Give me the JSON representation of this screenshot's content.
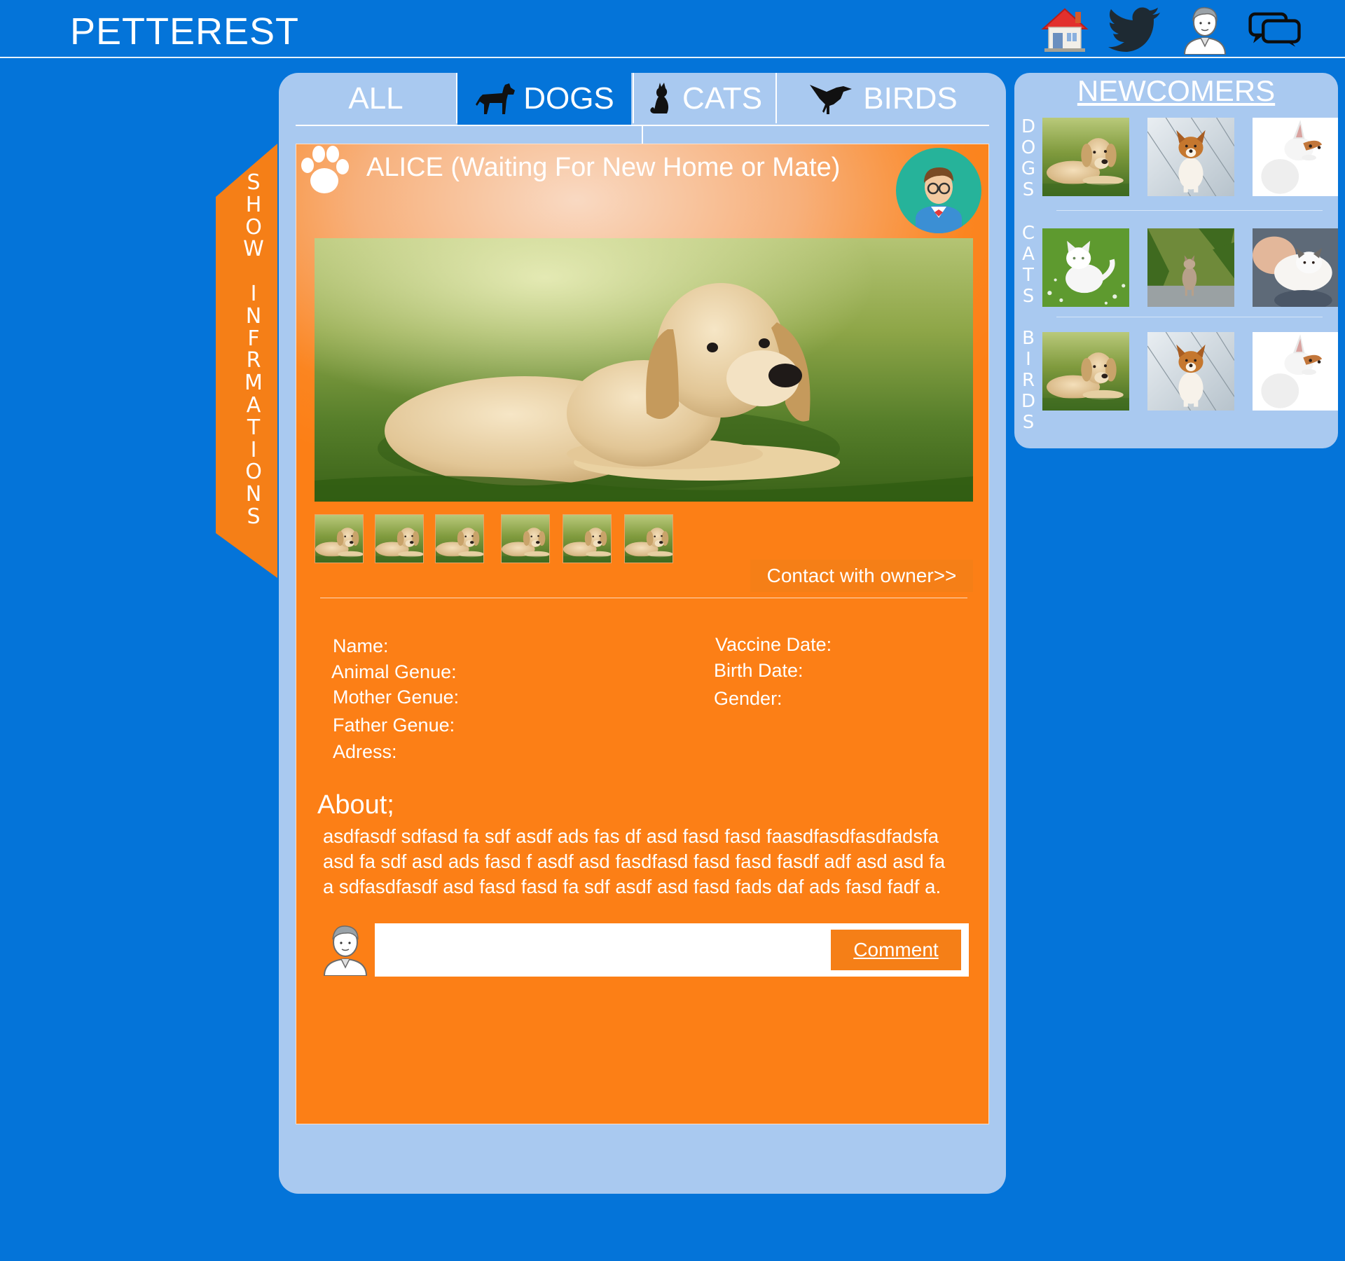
{
  "header": {
    "brand": "PETTEREST",
    "icons": [
      "home-icon",
      "twitter-icon",
      "profile-icon",
      "messages-icon"
    ]
  },
  "side_tab": {
    "label": "S\nH\nO\nW\n\nI\nN\nF\nR\nM\nA\nT\nI\nO\nN\nS"
  },
  "tabs": [
    {
      "label": "ALL",
      "icon": null
    },
    {
      "label": "DOGS",
      "icon": "dog-icon",
      "active": true
    },
    {
      "label": "CATS",
      "icon": "cat-icon"
    },
    {
      "label": "BIRDS",
      "icon": "bird-icon"
    }
  ],
  "pet": {
    "title": "ALICE (Waiting For New Home or Mate)",
    "contact_label": "Contact with owner>>",
    "thumbnail_count": 6,
    "fields_left": [
      "Name:",
      "Animal Genue:",
      "Mother Genue:",
      "Father Genue:",
      "Adress:"
    ],
    "fields_right": [
      "Vaccine Date:",
      "Birth Date:",
      "Gender:"
    ],
    "about_title": "About;",
    "about_lines": [
      "asdfasdf sdfasd fa sdf asdf ads fas df asd fasd fasd faasdfasdfasdfadsfa",
      "asd fa sdf asd ads fasd f asdf asd fasdfasd fasd fasd fasdf adf asd asd fa",
      "a sdfasdfasdf asd fasd fasd fa sdf asdf asd fasd fads daf ads fasd fadf a."
    ],
    "comment_placeholder": "",
    "comment_label": "Comment"
  },
  "newcomers": {
    "title": "NEWCOMERS",
    "groups": [
      {
        "label": "D\nO\nG\nS",
        "images": [
          "puppy-lying",
          "corgi-puppy",
          "white-dog"
        ]
      },
      {
        "label": "C\nA\nT\nS",
        "images": [
          "white-cat",
          "tabby-cat",
          "held-cat"
        ]
      },
      {
        "label": "B\nI\nR\nD\nS",
        "images": [
          "puppy-lying",
          "corgi-puppy",
          "white-dog"
        ]
      }
    ]
  },
  "colors": {
    "background": "#0474d9",
    "panel": "#a9c9f0",
    "accent": "#f57f17",
    "avatar_bg": "#26b39a"
  }
}
